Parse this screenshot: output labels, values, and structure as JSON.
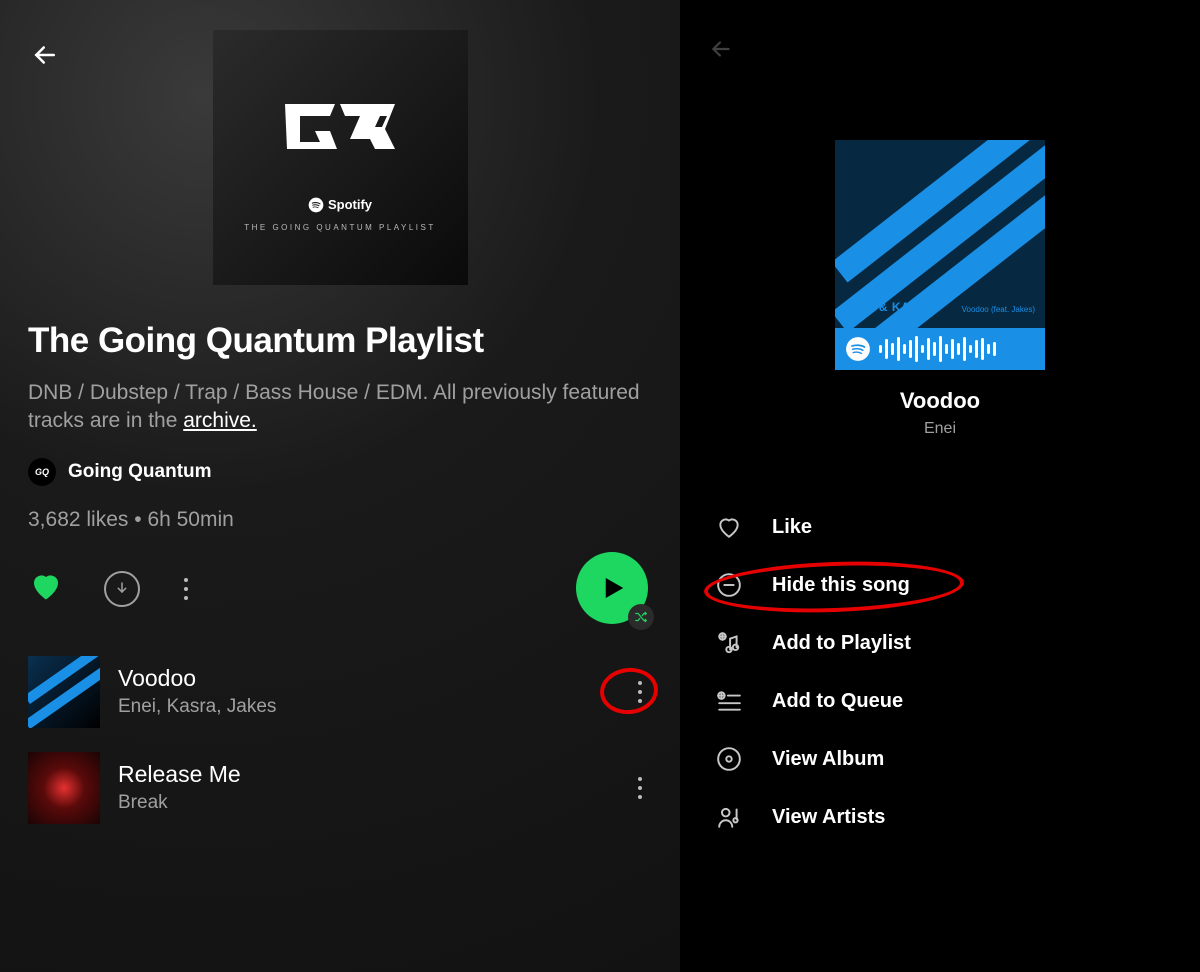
{
  "left": {
    "cover": {
      "spotify_label": "Spotify",
      "subtitle": "THE GOING QUANTUM PLAYLIST"
    },
    "title": "The Going Quantum Playlist",
    "description_prefix": "DNB / Dubstep / Trap / Bass House / EDM. All previously featured tracks are in the ",
    "description_link": "archive.",
    "author": "Going Quantum",
    "likes": "3,682 likes",
    "duration": "6h 50min",
    "tracks": [
      {
        "title": "Voodoo",
        "artist": "Enei, Kasra, Jakes"
      },
      {
        "title": "Release Me",
        "artist": "Break"
      }
    ]
  },
  "right": {
    "cover_label": "ENEI & KASRA",
    "cover_label2": "Voodoo (feat. Jakes)",
    "song_title": "Voodoo",
    "song_artist": "Enei",
    "menu": [
      {
        "label": "Like"
      },
      {
        "label": "Hide this song"
      },
      {
        "label": "Add to Playlist"
      },
      {
        "label": "Add to Queue"
      },
      {
        "label": "View Album"
      },
      {
        "label": "View Artists"
      }
    ]
  }
}
